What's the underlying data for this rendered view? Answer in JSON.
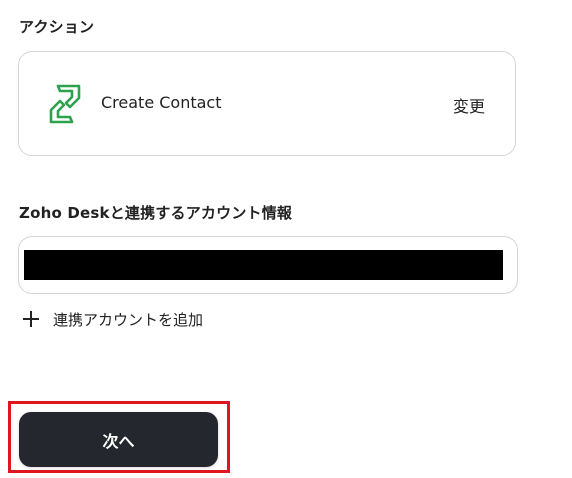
{
  "action_section": {
    "label": "アクション",
    "action_name": "Create Contact",
    "change_label": "変更",
    "icon": "zoho-desk-icon"
  },
  "account_section": {
    "label": "Zoho Deskと連携するアカウント情報",
    "add_account_label": "連携アカウントを追加"
  },
  "footer": {
    "next_label": "次へ"
  },
  "colors": {
    "zoho_green": "#2ca24c",
    "button_bg": "#25272e",
    "highlight": "#e0151d"
  }
}
